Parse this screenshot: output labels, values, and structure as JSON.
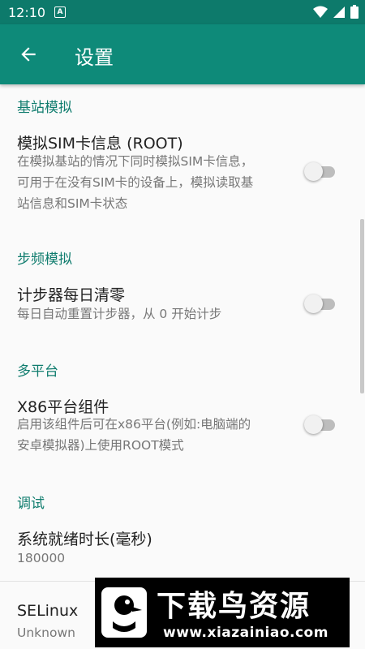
{
  "status_bar": {
    "time": "12:10",
    "notification_icon": "A"
  },
  "app_bar": {
    "title": "设置"
  },
  "sections": [
    {
      "header": "基站模拟",
      "prefs": [
        {
          "title": "模拟SIM卡信息 (ROOT)",
          "summary_lines": [
            "在模拟基站的情况下同时模拟SIM卡信息，",
            "可用于在没有SIM卡的设备上，模拟读取基",
            "站信息和SIM卡状态"
          ],
          "switch_on": false
        }
      ]
    },
    {
      "header": "步频模拟",
      "prefs": [
        {
          "title": "计步器每日清零",
          "summary_lines": [
            "每日自动重置计步器，从 0 开始计步"
          ],
          "switch_on": false
        }
      ]
    },
    {
      "header": "多平台",
      "prefs": [
        {
          "title": "X86平台组件",
          "summary_lines": [
            "启用该组件后可在x86平台(例如:电脑端的",
            "安卓模拟器)上使用ROOT模式"
          ],
          "switch_on": false
        }
      ]
    },
    {
      "header": "调试",
      "prefs": [
        {
          "title": "系统就绪时长(毫秒)",
          "summary_lines": [
            "180000"
          ]
        },
        {
          "title": "SELinux",
          "summary_lines": [
            "Unknown"
          ]
        }
      ]
    }
  ],
  "watermark": {
    "cn": "下载鸟资源",
    "url": "www.xiazainiao.com"
  },
  "colors": {
    "status_bar": "#0d7a6b",
    "app_bar": "#0e8a79",
    "accent": "#117d6f"
  }
}
